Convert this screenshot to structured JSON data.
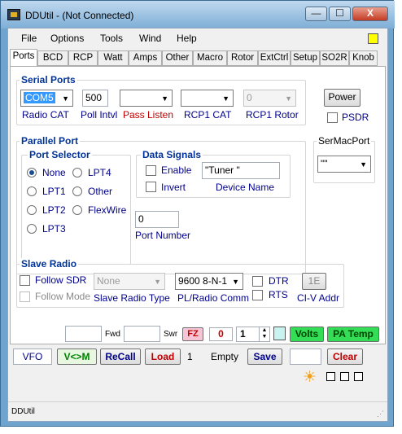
{
  "window": {
    "title": "DDUtil - (Not Connected)",
    "min": "—",
    "max": "☐",
    "close": "X"
  },
  "menu": [
    "File",
    "Options",
    "Tools",
    "Wind",
    "Help"
  ],
  "tabs": [
    "Ports",
    "BCD",
    "RCP",
    "Watt",
    "Amps",
    "Other",
    "Macro",
    "Rotor",
    "ExtCtrl",
    "Setup",
    "SO2R",
    "Knob"
  ],
  "serial": {
    "title": "Serial Ports",
    "radio_cat_value": "COM5",
    "radio_cat_label": "Radio CAT",
    "poll_value": "500",
    "poll_label": "Poll Intvl",
    "pass_listen_value": "",
    "pass_listen_label": "Pass Listen",
    "rcp1_cat_value": "",
    "rcp1_cat_label": "RCP1 CAT",
    "rcp1_rotor_value": "0",
    "rcp1_rotor_label": "RCP1 Rotor",
    "power_label": "Power",
    "psdr_label": "PSDR"
  },
  "parallel": {
    "title": "Parallel Port",
    "selector_title": "Port Selector",
    "options": [
      "None",
      "LPT1",
      "LPT2",
      "LPT3",
      "LPT4",
      "Other",
      "FlexWire"
    ],
    "signals_title": "Data Signals",
    "enable_label": "Enable",
    "invert_label": "Invert",
    "device_name_value": "\"Tuner \"",
    "device_name_label": "Device Name",
    "port_number_value": "0",
    "port_number_label": "Port Number"
  },
  "sermac": {
    "title": "SerMacPort",
    "value": "\"\""
  },
  "slave": {
    "title": "Slave Radio",
    "follow_sdr": "Follow SDR",
    "follow_mode": "Follow Mode",
    "type_value": "None",
    "type_label": "Slave Radio Type",
    "comm_value": "9600 8-N-1",
    "comm_label": "PL/Radio Comm",
    "dtr": "DTR",
    "rts": "RTS",
    "civ_value": "1E",
    "civ_label": "CI-V Addr"
  },
  "bottom": {
    "fwd_label": "Fwd",
    "swr_label": "Swr",
    "fz_label": "FZ",
    "red_value": "0",
    "spin_value": "1",
    "volts_label": "Volts",
    "patemp_label": "PA Temp",
    "vfo_label": "VFO",
    "vm_label": "V<>M",
    "recall_label": "ReCall",
    "load_label": "Load",
    "mem_num": "1",
    "empty_label": "Empty",
    "save_label": "Save",
    "clear_label": "Clear",
    "sun_glyph": "☀"
  },
  "status": {
    "text": "DDUtil"
  },
  "colors": {
    "accent_blue": "#003399",
    "red": "#c00000",
    "green_btn": "#33dd55",
    "pink_btn": "#f5c5d5"
  }
}
